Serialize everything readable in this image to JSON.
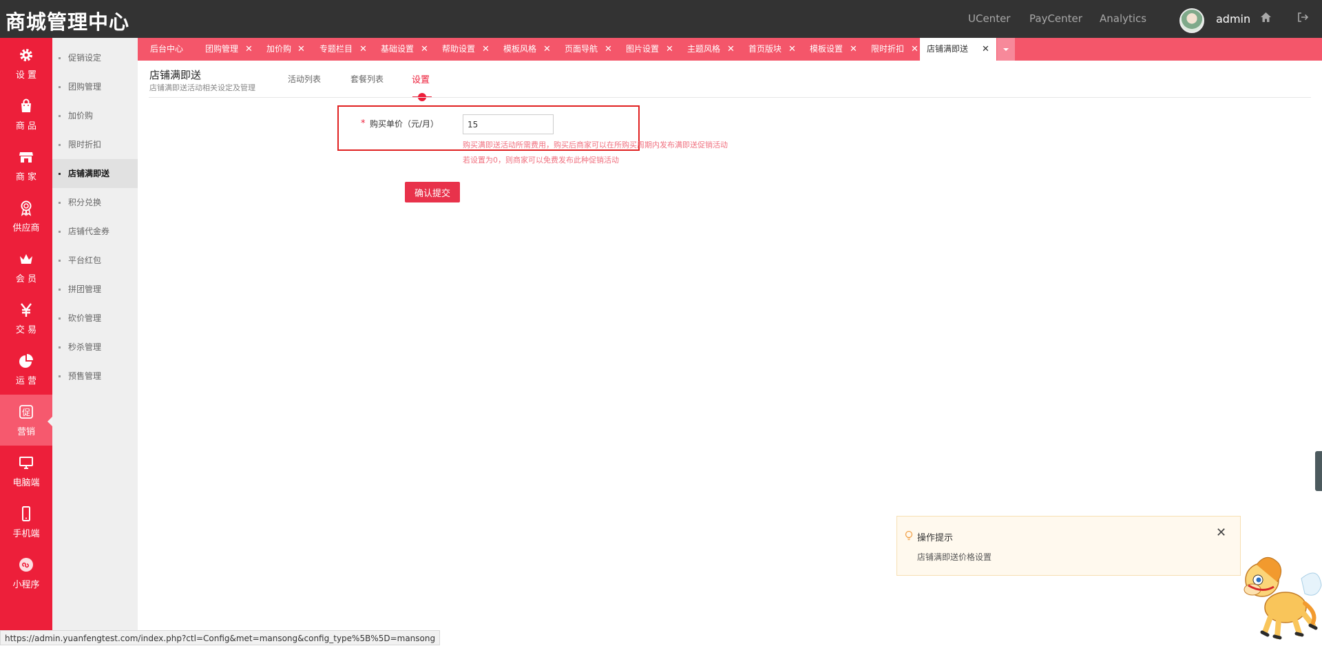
{
  "header": {
    "brand": "商城管理中心",
    "links": [
      "UCenter",
      "PayCenter",
      "Analytics"
    ],
    "user": "admin"
  },
  "sidebar": {
    "items": [
      {
        "label": "设 置",
        "icon": "gear-icon"
      },
      {
        "label": "商 品",
        "icon": "bag-icon"
      },
      {
        "label": "商 家",
        "icon": "store-icon"
      },
      {
        "label": "供应商",
        "icon": "award-icon"
      },
      {
        "label": "会 员",
        "icon": "crown-icon"
      },
      {
        "label": "交 易",
        "icon": "yen-icon"
      },
      {
        "label": "运 营",
        "icon": "pie-chart-icon"
      },
      {
        "label": "营销",
        "icon": "promo-icon"
      },
      {
        "label": "电脑端",
        "icon": "monitor-icon"
      },
      {
        "label": "手机端",
        "icon": "phone-icon"
      },
      {
        "label": "小程序",
        "icon": "mini-program-icon"
      }
    ],
    "active_index": 7
  },
  "subnav": {
    "items": [
      "促销设定",
      "团购管理",
      "加价购",
      "限时折扣",
      "店铺满即送",
      "积分兑换",
      "店铺代金券",
      "平台红包",
      "拼团管理",
      "砍价管理",
      "秒杀管理",
      "预售管理"
    ],
    "active_index": 4
  },
  "tabs": {
    "items": [
      "后台中心",
      "团购管理",
      "加价购",
      "专题栏目",
      "基础设置",
      "帮助设置",
      "模板风格",
      "页面导航",
      "图片设置",
      "主题风格",
      "首页版块",
      "模板设置",
      "限时折扣",
      "店铺满即送"
    ],
    "close_symbol": "✕",
    "active_index": 13
  },
  "page": {
    "title": "店铺满即送",
    "subtitle": "店铺满即送活动相关设定及管理",
    "tabs": [
      "活动列表",
      "套餐列表",
      "设置"
    ],
    "active_tab": 2
  },
  "form": {
    "required_mark": "*",
    "price_label": "购买单价（元/月）",
    "price_value": "15",
    "hint1": "购买满即送活动所需费用，购买后商家可以在所购买周期内发布满即送促销活动",
    "hint2": "若设置为0，则商家可以免费发布此种促销活动",
    "submit_label": "确认提交"
  },
  "tip": {
    "title": "操作提示",
    "text": "店铺满即送价格设置",
    "close_symbol": "✕"
  },
  "statusbar": {
    "url": "https://admin.yuanfengtest.com/index.php?ctl=Config&met=mansong&config_type%5B%5D=mansong"
  },
  "colors": {
    "topbar": "#333333",
    "sidebar": "#ed1f3a",
    "tabstrip": "#f4566a",
    "accent": "#ed1f3a"
  }
}
